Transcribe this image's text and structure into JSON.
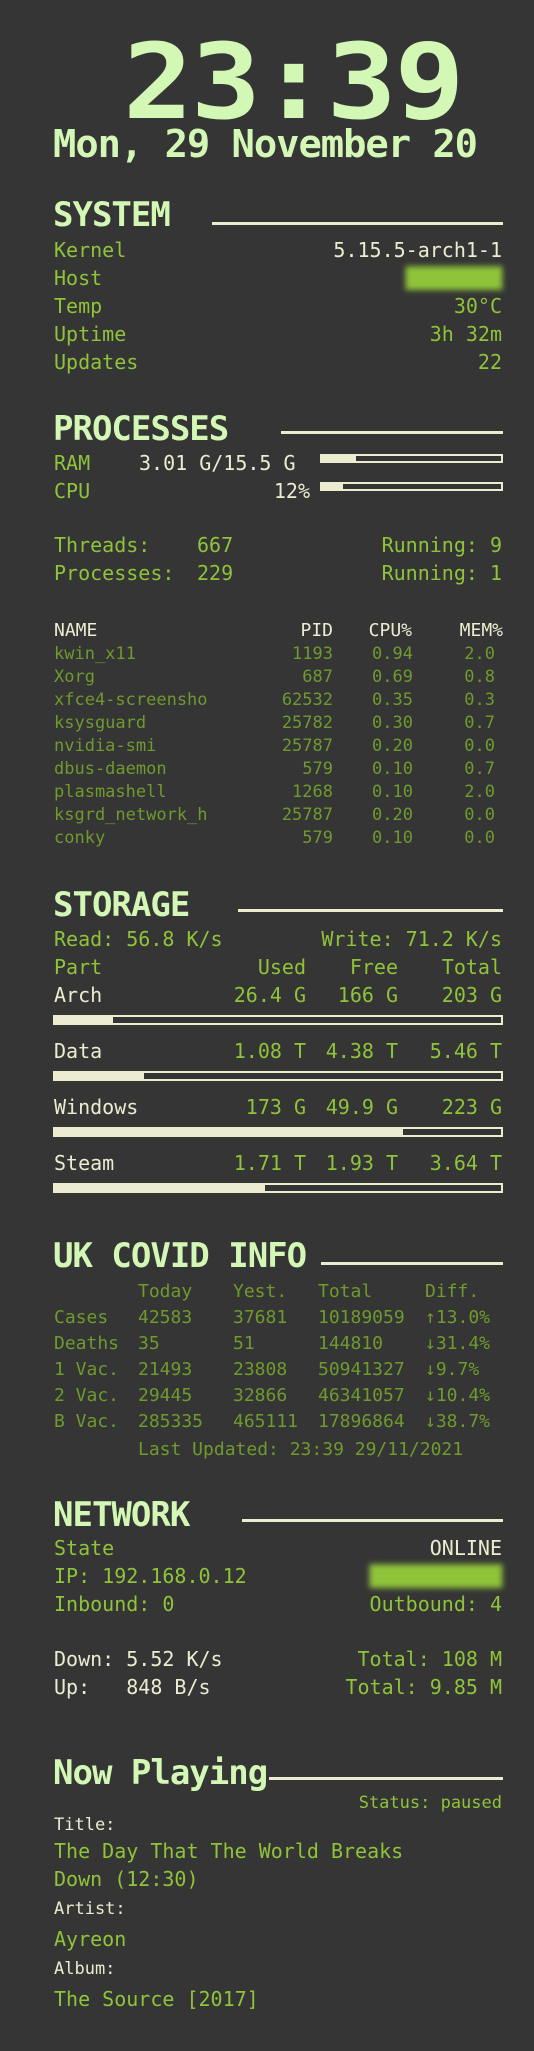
{
  "colors": {
    "background": "#353535",
    "green": "#8fc43a",
    "light_green": "#d3f7b5",
    "white": "#ececd0"
  },
  "header": {
    "time": "23:39",
    "date": "Mon, 29 November 20"
  },
  "system": {
    "title": "SYSTEM",
    "rows": [
      {
        "label": "Kernel",
        "value": "5.15.5-arch1-1"
      },
      {
        "label": "Host",
        "value": "████████"
      },
      {
        "label": "Temp",
        "value": "30°C"
      },
      {
        "label": "Uptime",
        "value": "3h 32m"
      },
      {
        "label": "Updates",
        "value": "22"
      }
    ]
  },
  "processes": {
    "title": "PROCESSES",
    "ram_label": "RAM",
    "ram_value": "3.01 G/15.5 G",
    "ram_fraction": 0.19,
    "cpu_label": "CPU",
    "cpu_value": "12%",
    "cpu_fraction": 0.12,
    "threads_label": "Threads:",
    "threads_value": "667",
    "threads_running": "Running: 9",
    "processes_label": "Processes:",
    "processes_value": "229",
    "processes_running": "Running: 1",
    "table_headers": [
      "NAME",
      "PID",
      "CPU%",
      "MEM%"
    ],
    "table": [
      [
        "kwin_x11",
        "1193",
        "0.94",
        "2.0"
      ],
      [
        "Xorg",
        "687",
        "0.69",
        "0.8"
      ],
      [
        "xfce4-screensho",
        "62532",
        "0.35",
        "0.3"
      ],
      [
        "ksysguard",
        "25782",
        "0.30",
        "0.7"
      ],
      [
        "nvidia-smi",
        "25787",
        "0.20",
        "0.0"
      ],
      [
        "dbus-daemon",
        "579",
        "0.10",
        "0.7"
      ],
      [
        "plasmashell",
        "1268",
        "0.10",
        "2.0"
      ],
      [
        "ksgrd_network_h",
        "25787",
        "0.20",
        "0.0"
      ],
      [
        "conky",
        "579",
        "0.10",
        "0.0"
      ]
    ]
  },
  "storage": {
    "title": "STORAGE",
    "read": "Read: 56.8 K/s",
    "write": "Write: 71.2 K/s",
    "headers": [
      "Part",
      "Used",
      "Free",
      "Total"
    ],
    "parts": [
      {
        "name": "Arch",
        "used": "26.4 G",
        "free": "166 G",
        "total": "203 G",
        "fraction": 0.13
      },
      {
        "name": "Data",
        "used": "1.08 T",
        "free": "4.38 T",
        "total": "5.46 T",
        "fraction": 0.2
      },
      {
        "name": "Windows",
        "used": "173 G",
        "free": "49.9 G",
        "total": "223 G",
        "fraction": 0.78
      },
      {
        "name": "Steam",
        "used": "1.71 T",
        "free": "1.93 T",
        "total": "3.64 T",
        "fraction": 0.47
      }
    ]
  },
  "covid": {
    "title": "UK COVID INFO",
    "headers": [
      "Today",
      "Yest.",
      "Total",
      "Diff."
    ],
    "rows": [
      [
        "Cases",
        "42583",
        "37681",
        "10189059",
        "↑13.0%"
      ],
      [
        "Deaths",
        "35",
        "51",
        "144810",
        "↓31.4%"
      ],
      [
        "1 Vac.",
        "21493",
        "23808",
        "50941327",
        "↓9.7%"
      ],
      [
        "2 Vac.",
        "29445",
        "32866",
        "46341057",
        "↓10.4%"
      ],
      [
        "B Vac.",
        "285335",
        "465111",
        "17896864",
        "↓38.7%"
      ]
    ],
    "updated": "Last Updated: 23:39 29/11/2021"
  },
  "network": {
    "title": "NETWORK",
    "state_label": "State",
    "state_value": "ONLINE",
    "ip": "IP: 192.168.0.12",
    "public_ip": "███████████",
    "inbound": "Inbound: 0",
    "outbound": "Outbound: 4",
    "down": "Down: 5.52 K/s",
    "down_total": "Total: 108 M",
    "up": "Up:   848 B/s",
    "up_total": "Total: 9.85 M"
  },
  "now_playing": {
    "title": "Now Playing",
    "status": "Status: paused",
    "title_label": "Title:",
    "title_value_1": "The Day That The World Breaks",
    "title_value_2": "Down (12:30)",
    "artist_label": "Artist:",
    "artist_value": "Ayreon",
    "album_label": "Album:",
    "album_value": "The Source [2017]"
  }
}
